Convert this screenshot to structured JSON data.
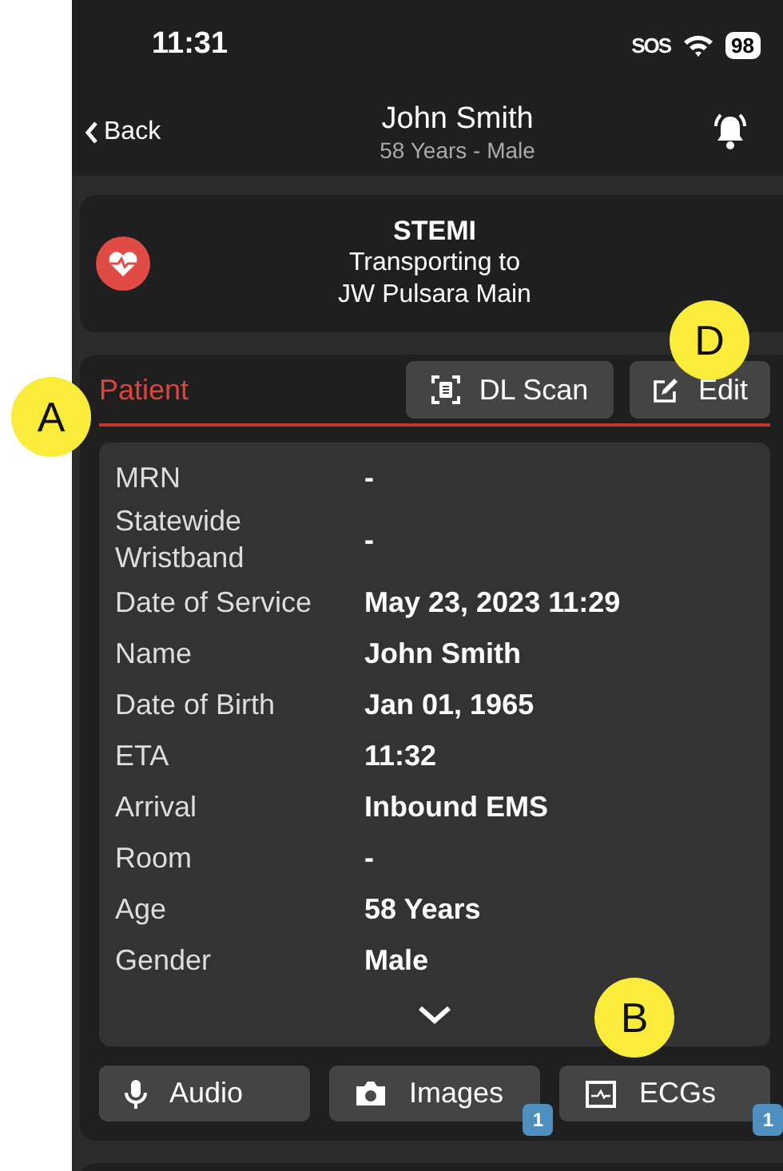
{
  "status_bar": {
    "time": "11:31",
    "sos": "SOS",
    "battery": "98"
  },
  "nav": {
    "back": "Back",
    "title": "John Smith",
    "subtitle": "58 Years - Male"
  },
  "alert_card": {
    "title": "STEMI",
    "line1": "Transporting to",
    "line2": "JW Pulsara Main"
  },
  "patient": {
    "heading": "Patient",
    "buttons": [
      {
        "kind": "scan",
        "label": "DL Scan"
      },
      {
        "kind": "edit",
        "label": "Edit"
      }
    ],
    "fields": [
      {
        "label": "MRN",
        "value": "-"
      },
      {
        "label": "Statewide Wristband",
        "value": "-"
      },
      {
        "label": "Date of Service",
        "value": "May 23, 2023 11:29"
      },
      {
        "label": "Name",
        "value": "John Smith"
      },
      {
        "label": "Date of Birth",
        "value": "Jan 01, 1965"
      },
      {
        "label": "ETA",
        "value": "11:32"
      },
      {
        "label": "Arrival",
        "value": "Inbound EMS"
      },
      {
        "label": "Room",
        "value": "-"
      },
      {
        "label": "Age",
        "value": "58 Years"
      },
      {
        "label": "Gender",
        "value": "Male"
      }
    ],
    "media": [
      {
        "kind": "audio",
        "label": "Audio"
      },
      {
        "kind": "images",
        "label": "Images",
        "badge": "1"
      },
      {
        "kind": "ecg",
        "label": "ECGs",
        "badge": "1"
      }
    ]
  },
  "callouts": [
    {
      "label": "A"
    },
    {
      "label": "D"
    },
    {
      "label": "B"
    }
  ]
}
